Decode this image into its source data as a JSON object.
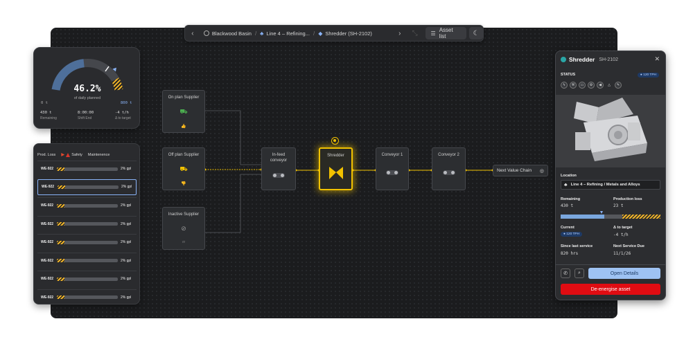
{
  "colors": {
    "accent_yellow": "#f2c200",
    "accent_blue": "#8ab4f8",
    "danger": "#e00c12",
    "canvas": "#1b1c1e"
  },
  "toolbar": {
    "crumbs": [
      {
        "label": "Blackwood Basin",
        "icon": "site-icon"
      },
      {
        "label": "Line 4 – Refining...",
        "icon": "line-icon"
      },
      {
        "label": "Shredder (SH-2102)",
        "icon": "cube-icon"
      }
    ],
    "asset_list_label": "Asset list"
  },
  "gauge": {
    "value": "46.2%",
    "subtitle": "of daily planned",
    "progress": 0.462,
    "min_label": "0 t",
    "max_label": "800 t",
    "remaining_value": "430 t",
    "remaining_label": "Remaining",
    "shift_value": "8:00:00",
    "shift_label": "Shift End",
    "delta_value": "-4 t/h",
    "delta_label": "Δ to target"
  },
  "prod_loss": {
    "tabs": {
      "prod_loss": "Prod. Loss",
      "safety": "Safety",
      "maintenance": "Maintenence"
    },
    "rows": [
      {
        "id": "WE-922",
        "pct": "2% gpl",
        "fill": 0.12
      },
      {
        "id": "WE-922",
        "pct": "2% gpl",
        "fill": 0.12
      },
      {
        "id": "WE-922",
        "pct": "2% gpl",
        "fill": 0.12
      },
      {
        "id": "WE-922",
        "pct": "2% gpl",
        "fill": 0.12
      },
      {
        "id": "WE-922",
        "pct": "2% gpl",
        "fill": 0.12
      },
      {
        "id": "WE-922",
        "pct": "2% gpl",
        "fill": 0.12
      },
      {
        "id": "WE-922",
        "pct": "2% gpl",
        "fill": 0.12
      },
      {
        "id": "WE-922",
        "pct": "2% gpl",
        "fill": 0.12
      }
    ],
    "selected_index": 1
  },
  "flow": {
    "on_plan": "On plan Supplier",
    "off_plan": "Off plan Supplier",
    "inactive": "Inactive Supplier",
    "infeed": "In-feed conveyor",
    "shredder": "Shredder",
    "conveyor1": "Conveyor 1",
    "conveyor2": "Conveyor 2",
    "next_chain": "Next Value Chain"
  },
  "panel": {
    "title": "Shredder",
    "code": "SH-2102",
    "status_label": "STATUS",
    "tph_badge": "● 120 TPH",
    "location_label": "Location",
    "location_value": "Line 4 – Refining / Metals and Alloys",
    "remaining_label": "Remaining",
    "remaining_value": "430 t",
    "loss_label": "Production loss",
    "loss_value": "23 t",
    "progress": {
      "remaining_fraction": 0.44,
      "loss_fraction": 0.38,
      "marker_fraction": 0.41
    },
    "current_label": "Current",
    "current_badge": "● 120 TPH",
    "delta_label": "Δ to target",
    "delta_value": "-4 t/h",
    "since_label": "Since last service",
    "since_value": "820 hrs",
    "next_label": "Next Service Due",
    "next_value": "11/1/26",
    "open_details": "Open Details",
    "de_energise": "De-energise asset"
  }
}
